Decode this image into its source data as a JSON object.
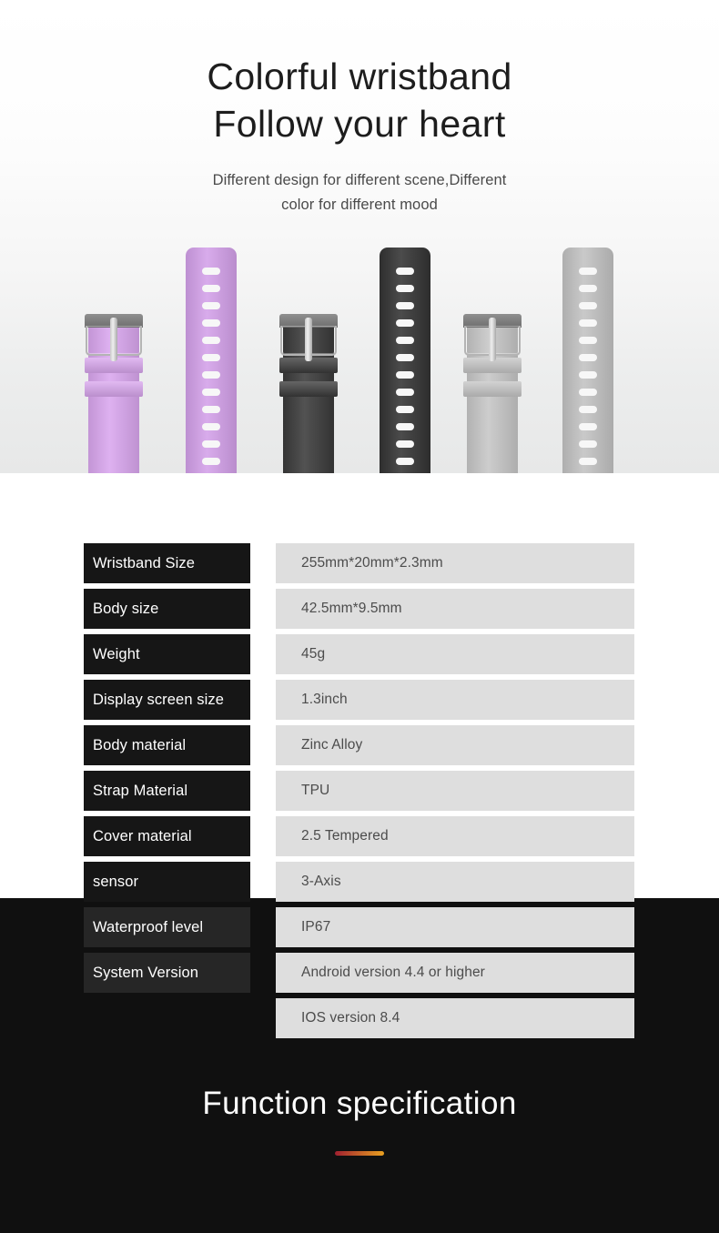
{
  "hero": {
    "title_line1": "Colorful wristband",
    "title_line2": "Follow your heart",
    "subtitle_line1": "Different design for different scene,Different",
    "subtitle_line2": "color for different mood",
    "straps": [
      {
        "name": "purple-buckle-strap",
        "type": "buckle",
        "color": "#d9a6ee"
      },
      {
        "name": "purple-tail-strap",
        "type": "tail",
        "color": "#d3a0e9"
      },
      {
        "name": "black-buckle-strap",
        "type": "buckle",
        "color": "#3a3a3a"
      },
      {
        "name": "black-tail-strap",
        "type": "tail",
        "color": "#333333"
      },
      {
        "name": "grey-buckle-strap",
        "type": "buckle",
        "color": "#c6c6c6"
      },
      {
        "name": "grey-tail-strap",
        "type": "tail",
        "color": "#c2c2c2"
      }
    ]
  },
  "spec_table": {
    "rows": [
      {
        "label": "Wristband Size",
        "value": "255mm*20mm*2.3mm"
      },
      {
        "label": "Body size",
        "value": "42.5mm*9.5mm"
      },
      {
        "label": "Weight",
        "value": "45g"
      },
      {
        "label": "Display screen size",
        "value": "1.3inch"
      },
      {
        "label": "Body material",
        "value": "Zinc Alloy"
      },
      {
        "label": "Strap Material",
        "value": "TPU"
      },
      {
        "label": "Cover material",
        "value": "2.5 Tempered"
      },
      {
        "label": "sensor",
        "value": "3-Axis"
      },
      {
        "label": "Waterproof level",
        "value": "IP67"
      },
      {
        "label": "System Version",
        "value": "Android version 4.4 or higher"
      },
      {
        "label": "",
        "value": "IOS version 8.4"
      }
    ]
  },
  "footer": {
    "title": "Function specification",
    "rule_color_start": "#a02030",
    "rule_color_end": "#e8a020"
  },
  "colors": {
    "label_pill_light_bg": "#161616",
    "label_pill_dark_bg": "#262626",
    "value_pill_bg": "#dedede",
    "dark_section_bg": "#101010"
  }
}
